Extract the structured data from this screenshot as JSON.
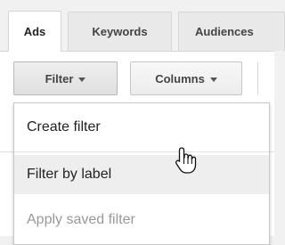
{
  "tabs": [
    {
      "label": "Ads",
      "active": true
    },
    {
      "label": "Keywords",
      "active": false
    },
    {
      "label": "Audiences",
      "active": false
    }
  ],
  "toolbar": {
    "filter_label": "Filter",
    "columns_label": "Columns"
  },
  "filter_menu": {
    "items": [
      {
        "label": "Create filter",
        "enabled": true
      },
      {
        "label": "Filter by label",
        "enabled": true,
        "hovered": true
      },
      {
        "label": "Apply saved filter",
        "enabled": false
      }
    ]
  },
  "cursor": {
    "icon": "hand-pointer-icon"
  },
  "colors": {
    "hover_bg": "#eeeeee",
    "disabled_text": "#999999"
  }
}
